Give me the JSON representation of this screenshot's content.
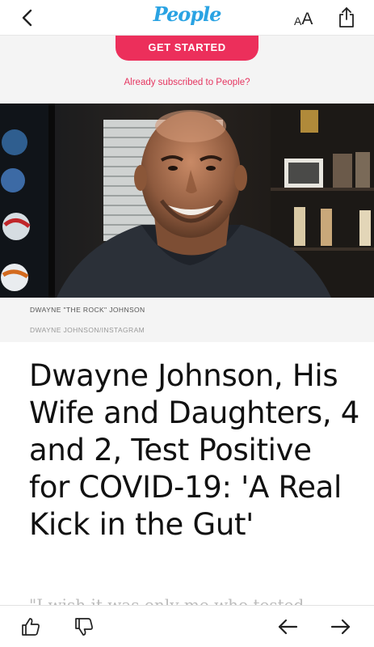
{
  "header": {
    "back_icon": "chevron-left-icon",
    "logo_text": "People",
    "text_size": {
      "small": "A",
      "large": "A"
    },
    "share_icon": "share-icon"
  },
  "subscribe": {
    "cta_label": "GET STARTED",
    "already_text": "Already subscribed to People?"
  },
  "photo": {
    "caption": "DWAYNE \"THE ROCK\" JOHNSON",
    "credit": "DWAYNE JOHNSON/INSTAGRAM"
  },
  "article": {
    "headline": "Dwayne Johnson, His Wife and Daughters, 4 and 2, Test Positive for COVID-19: 'A Real Kick in the Gut'",
    "teaser": "\"I wish it was only me who tested"
  },
  "bottom_bar": {
    "icons": [
      "thumbs-up-icon",
      "thumbs-down-icon",
      "arrow-left-icon",
      "arrow-right-icon"
    ]
  },
  "colors": {
    "brand_blue": "#2aa3e3",
    "cta_pink": "#ec2f5b"
  }
}
